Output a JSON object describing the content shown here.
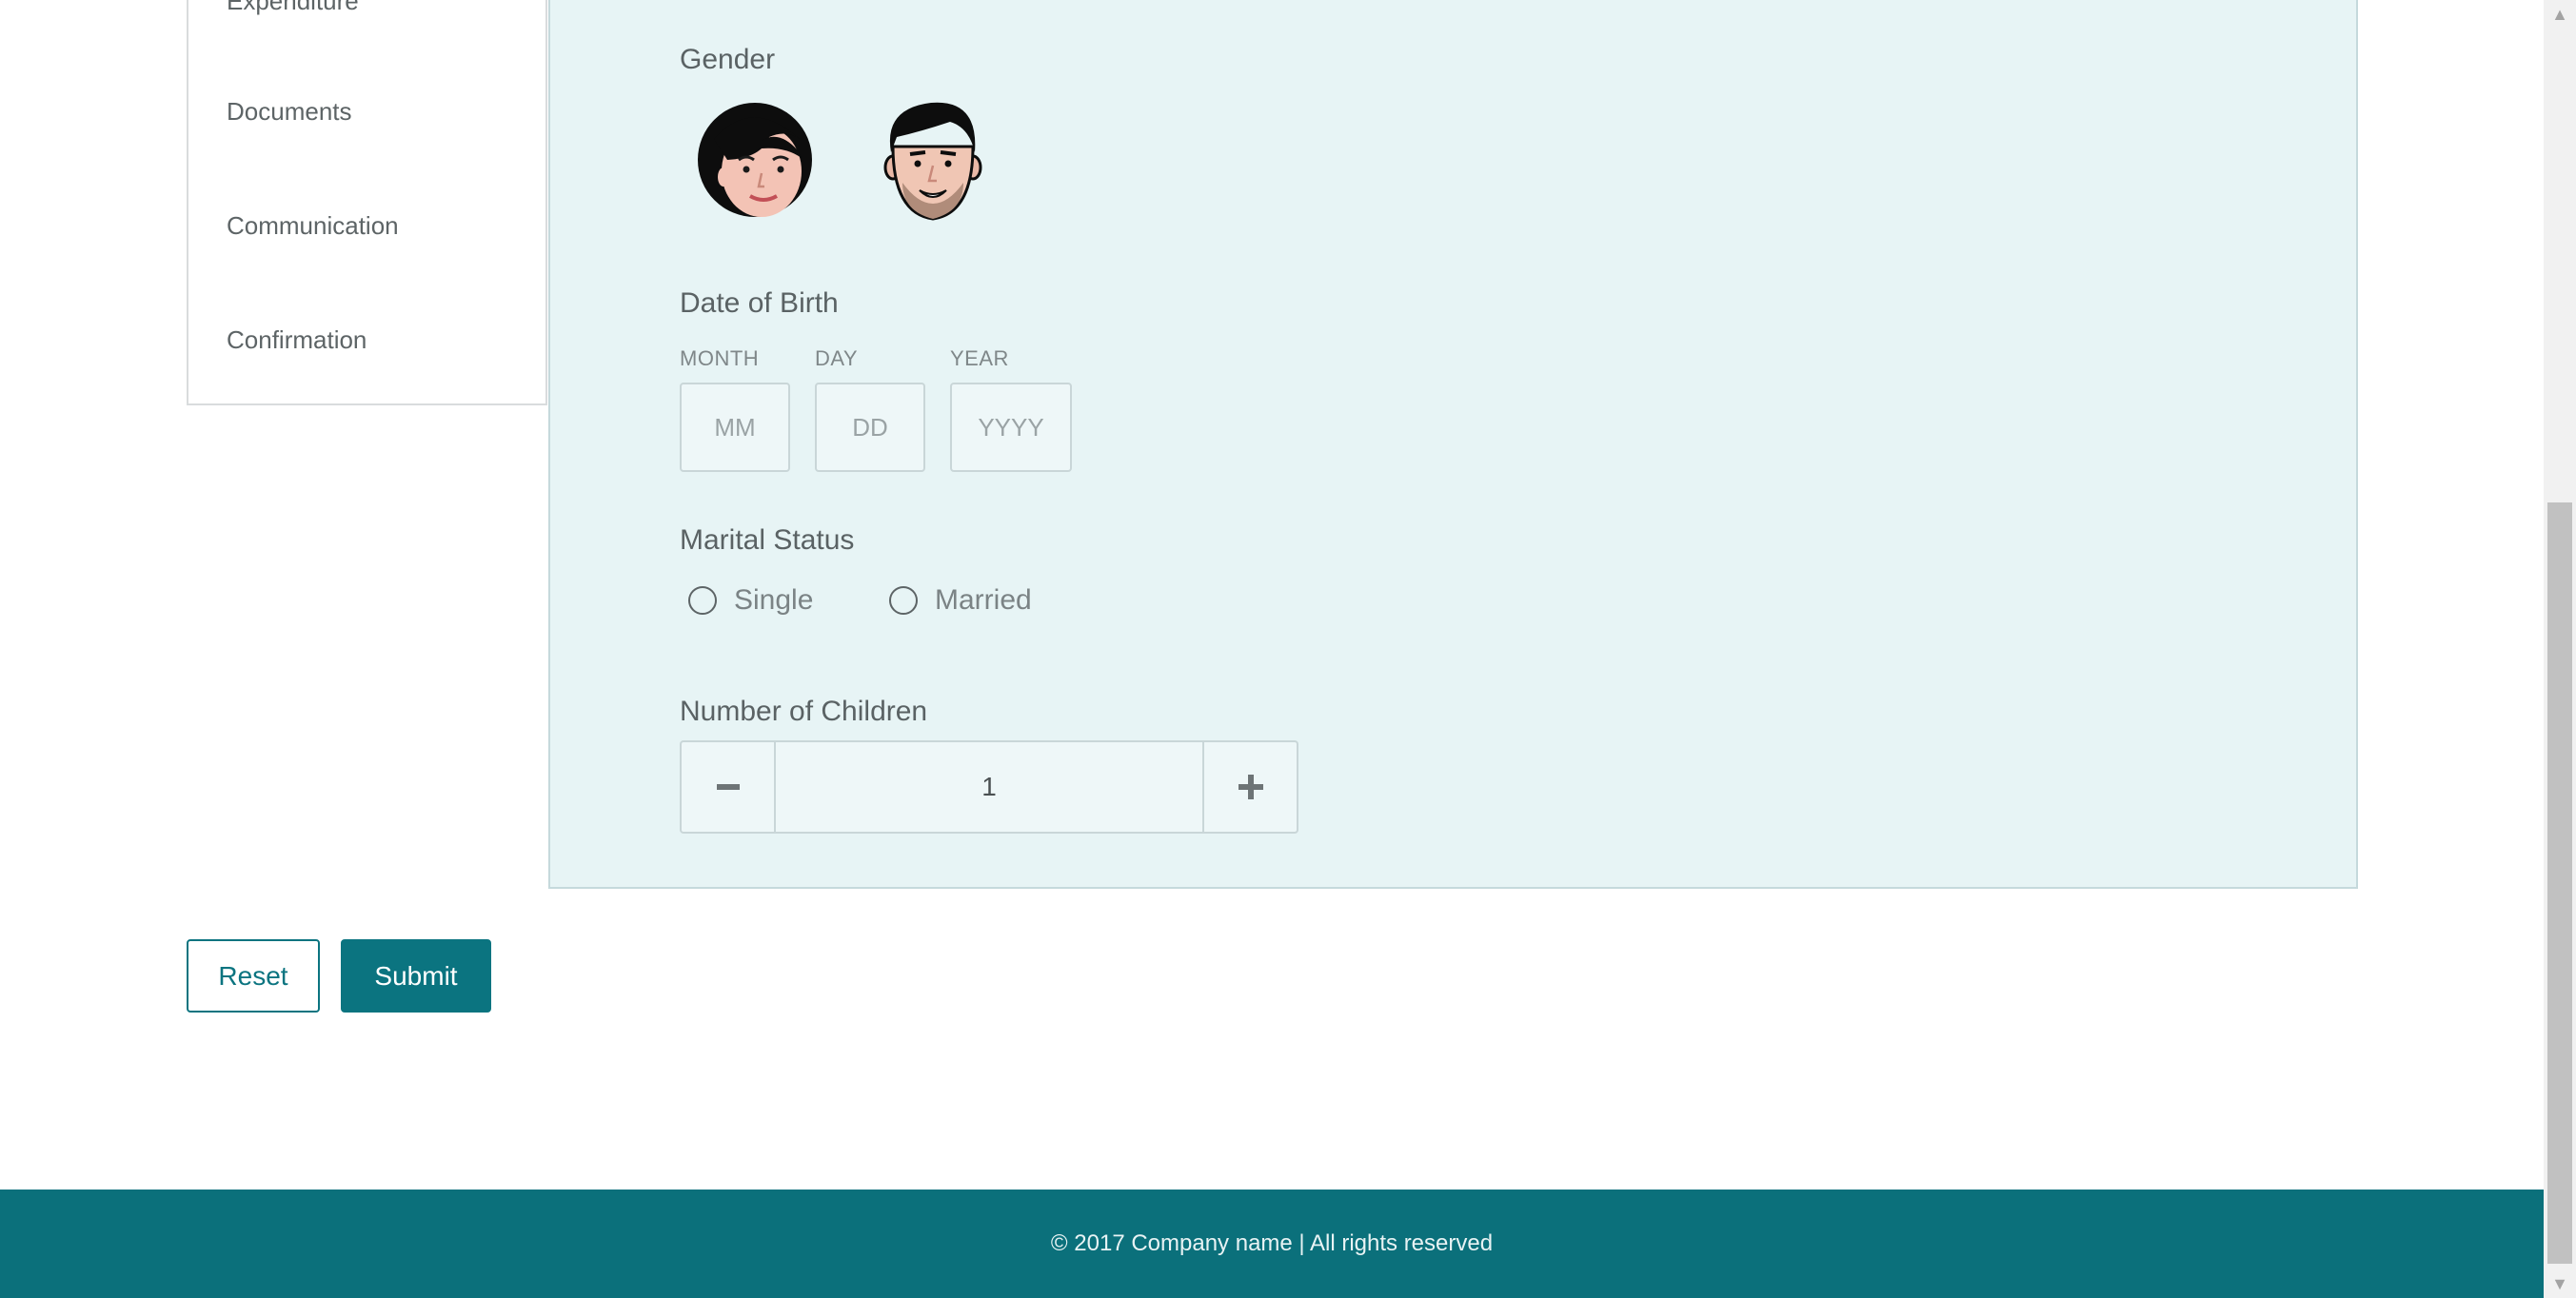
{
  "sidebar": {
    "items": [
      {
        "label": "Expenditure"
      },
      {
        "label": "Documents"
      },
      {
        "label": "Communication"
      },
      {
        "label": "Confirmation"
      }
    ]
  },
  "form": {
    "gender": {
      "label": "Gender",
      "options": [
        {
          "icon": "female-avatar-icon"
        },
        {
          "icon": "male-avatar-icon"
        }
      ]
    },
    "dob": {
      "label": "Date of Birth",
      "month": {
        "label": "MONTH",
        "placeholder": "MM",
        "value": ""
      },
      "day": {
        "label": "DAY",
        "placeholder": "DD",
        "value": ""
      },
      "year": {
        "label": "YEAR",
        "placeholder": "YYYY",
        "value": ""
      }
    },
    "marital": {
      "label": "Marital Status",
      "options": [
        {
          "label": "Single",
          "checked": false
        },
        {
          "label": "Married",
          "checked": false
        }
      ]
    },
    "children": {
      "label": "Number of Children",
      "value": "1",
      "minus_icon": "minus-icon",
      "plus_icon": "plus-icon"
    }
  },
  "actions": {
    "reset_label": "Reset",
    "submit_label": "Submit"
  },
  "footer": {
    "text": "© 2017 Company name | All rights reserved"
  },
  "colors": {
    "accent": "#0b7480",
    "panel_bg": "#e7f4f5",
    "footer_bg": "#0b707b"
  }
}
